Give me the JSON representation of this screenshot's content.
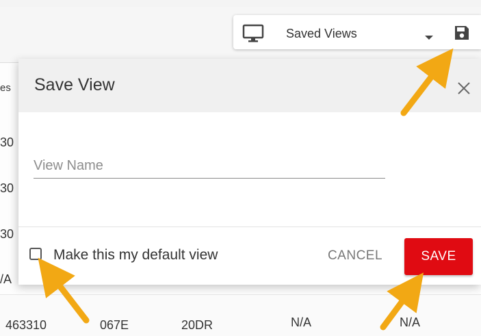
{
  "toolbar": {
    "views_label": "Saved Views",
    "icons": {
      "monitor": "monitor-icon",
      "dropdown": "caret-down-icon",
      "save": "floppy-disk-icon"
    }
  },
  "background_table": {
    "header_fragment": "es",
    "row_fragments": [
      "30",
      "30",
      "30",
      "/A"
    ],
    "bottom_row": [
      "463310",
      "067E",
      "20DR",
      "N/A",
      "N/A"
    ]
  },
  "modal": {
    "title": "Save View",
    "close_icon": "close-icon",
    "field": {
      "placeholder": "View Name",
      "value": ""
    },
    "checkbox": {
      "label": "Make this my default view",
      "checked": false
    },
    "cancel_label": "CANCEL",
    "save_label": "SAVE"
  },
  "colors": {
    "save_button": "#e00b12",
    "annotation_arrow": "#f2a814",
    "modal_header": "#f0f0f0"
  }
}
